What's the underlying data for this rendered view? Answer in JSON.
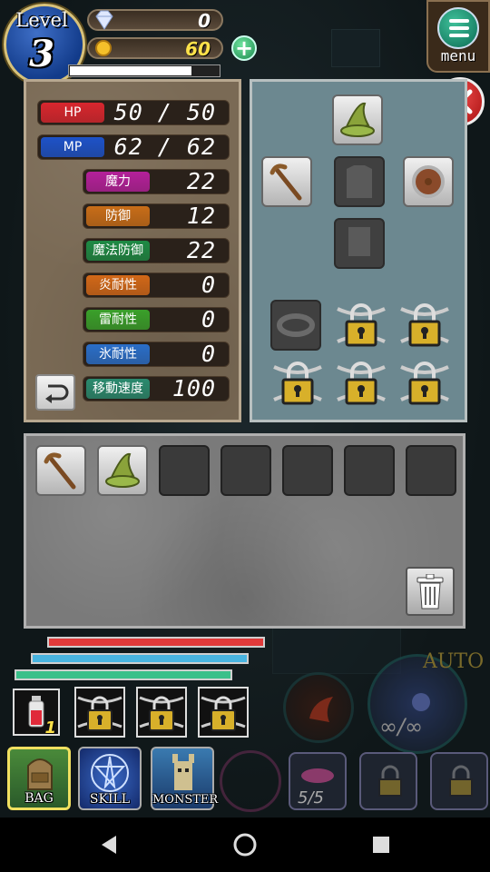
{
  "hud": {
    "level_label": "Level",
    "level_value": "3",
    "diamonds": "0",
    "gold": "60",
    "exp_fraction": 0.82,
    "menu_label": "menu"
  },
  "stats": [
    {
      "label": "HP",
      "value": "50 / 50",
      "color": "#d8262e"
    },
    {
      "label": "MP",
      "value": "62 / 62",
      "color": "#1d52c8"
    },
    {
      "label": "魔力",
      "value": "22",
      "color": "#b4209a"
    },
    {
      "label": "防御",
      "value": "12",
      "color": "#c86d18"
    },
    {
      "label": "魔法防御",
      "value": "22",
      "color": "#1e8a44"
    },
    {
      "label": "炎耐性",
      "value": "0",
      "color": "#d26818"
    },
    {
      "label": "雷耐性",
      "value": "0",
      "color": "#3aa02a"
    },
    {
      "label": "氷耐性",
      "value": "0",
      "color": "#2a6ec8"
    },
    {
      "label": "移動速度",
      "value": "100",
      "color": "#2a8a6e"
    }
  ],
  "bottom_hud": {
    "potion_count": "1",
    "buttons": [
      {
        "label": "BAG"
      },
      {
        "label": "SKILL"
      },
      {
        "label": "MONSTER"
      }
    ],
    "auto_label": "AUTO",
    "infinity_label": "∞/∞",
    "summon_count": "5/5"
  },
  "colors": {
    "hp_bar": "#e03a3a",
    "mp_bar": "#48b4e0",
    "st_bar": "#3ac08a"
  }
}
